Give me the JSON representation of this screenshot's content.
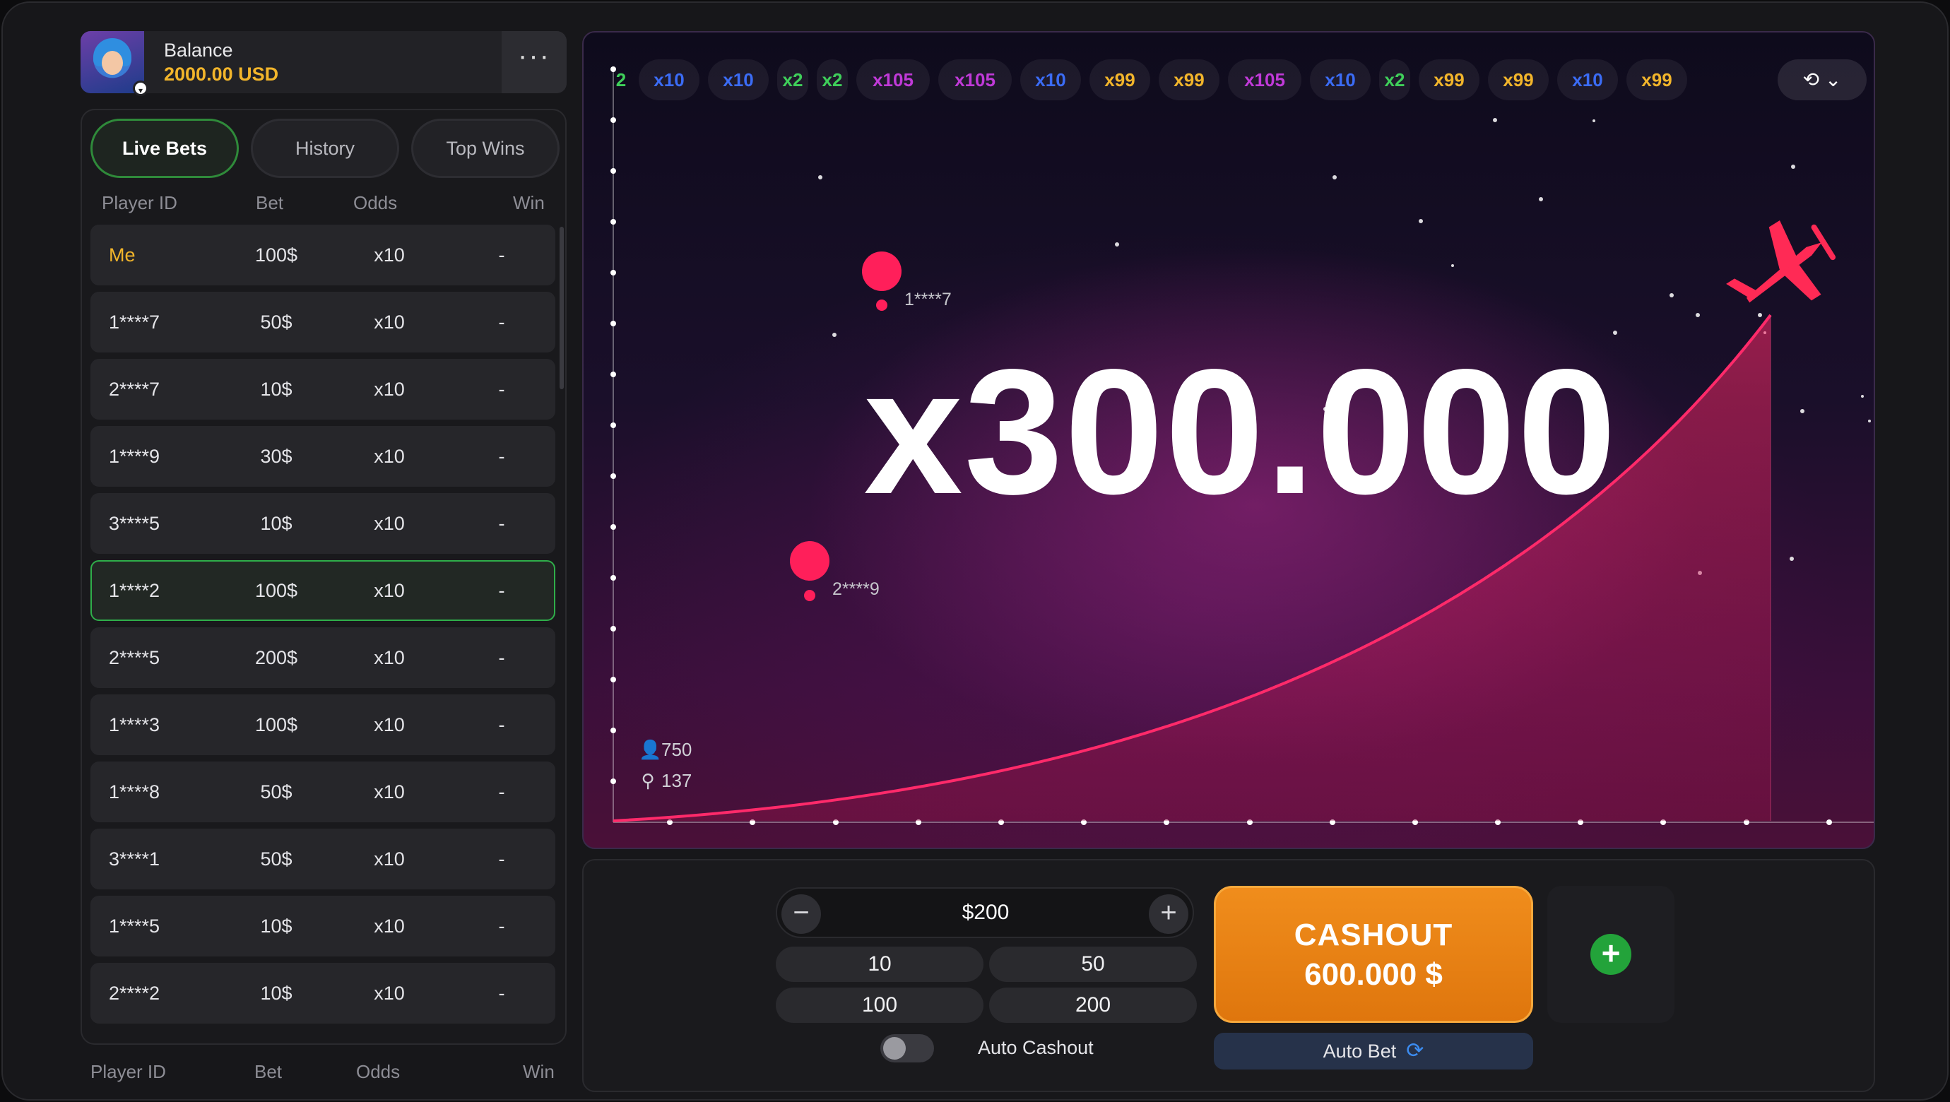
{
  "profile": {
    "balance_label": "Balance",
    "balance_value": "2000.00 USD",
    "more_label": "···"
  },
  "tabs": [
    "Live Bets",
    "History",
    "Top Wins"
  ],
  "columns": {
    "player_id": "Player ID",
    "bet": "Bet",
    "odds": "Odds",
    "win": "Win"
  },
  "bets": [
    {
      "id": "Me",
      "bet": "100$",
      "odds": "x10",
      "win": "-"
    },
    {
      "id": "1****7",
      "bet": "50$",
      "odds": "x10",
      "win": "-"
    },
    {
      "id": "2****7",
      "bet": "10$",
      "odds": "x10",
      "win": "-"
    },
    {
      "id": "1****9",
      "bet": "30$",
      "odds": "x10",
      "win": "-"
    },
    {
      "id": "3****5",
      "bet": "10$",
      "odds": "x10",
      "win": "-"
    },
    {
      "id": "1****2",
      "bet": "100$",
      "odds": "x10",
      "win": "-"
    },
    {
      "id": "2****5",
      "bet": "200$",
      "odds": "x10",
      "win": "-"
    },
    {
      "id": "1****3",
      "bet": "100$",
      "odds": "x10",
      "win": "-"
    },
    {
      "id": "1****8",
      "bet": "50$",
      "odds": "x10",
      "win": "-"
    },
    {
      "id": "3****1",
      "bet": "50$",
      "odds": "x10",
      "win": "-"
    },
    {
      "id": "1****5",
      "bet": "10$",
      "odds": "x10",
      "win": "-"
    },
    {
      "id": "2****2",
      "bet": "10$",
      "odds": "x10",
      "win": "-"
    }
  ],
  "history_strip": [
    {
      "label": "2",
      "color": "#3fcf5a"
    },
    {
      "label": "x10",
      "color": "#3b6cf5"
    },
    {
      "label": "x10",
      "color": "#3b6cf5"
    },
    {
      "label": "x2",
      "color": "#3fcf5a"
    },
    {
      "label": "x2",
      "color": "#3fcf5a"
    },
    {
      "label": "x105",
      "color": "#c03ad8"
    },
    {
      "label": "x105",
      "color": "#c03ad8"
    },
    {
      "label": "x10",
      "color": "#3b6cf5"
    },
    {
      "label": "x99",
      "color": "#f2b52b"
    },
    {
      "label": "x99",
      "color": "#f2b52b"
    },
    {
      "label": "x105",
      "color": "#c03ad8"
    },
    {
      "label": "x10",
      "color": "#3b6cf5"
    },
    {
      "label": "x2",
      "color": "#3fcf5a"
    },
    {
      "label": "x99",
      "color": "#f2b52b"
    },
    {
      "label": "x99",
      "color": "#f2b52b"
    },
    {
      "label": "x10",
      "color": "#3b6cf5"
    },
    {
      "label": "x99",
      "color": "#f2b52b"
    }
  ],
  "history_icon": "history-clock-icon",
  "game": {
    "multiplier": "x300.000",
    "players_on_chart": [
      "1****7",
      "2****9"
    ],
    "online_count": "750",
    "bettors_count": "137",
    "accent": "#ff1f5a"
  },
  "controls": {
    "amount": "$200",
    "minus_label": "−",
    "plus_label": "+",
    "quick_amounts": [
      "10",
      "50",
      "100",
      "200"
    ],
    "auto_cashout_label": "Auto Cashout",
    "auto_cashout_enabled": false,
    "cashout_title": "CASHOUT",
    "cashout_amount": "600.000 $",
    "auto_bet_label": "Auto Bet",
    "add_label": "+"
  }
}
